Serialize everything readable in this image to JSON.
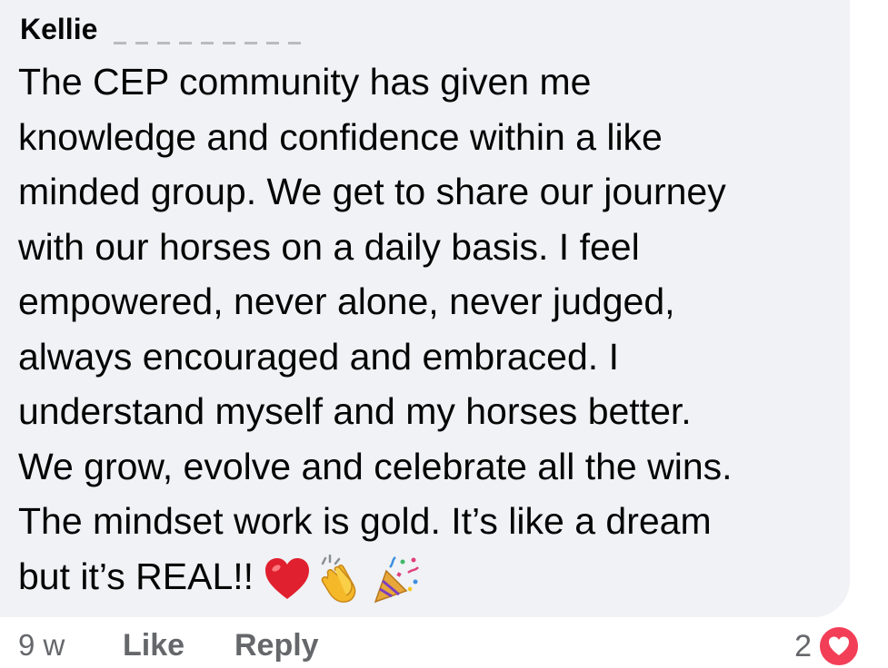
{
  "comment": {
    "author_name": "Kellie",
    "text_lines": [
      "The CEP community has given me",
      "knowledge and confidence within a like",
      "minded group. We get to share our journey",
      "with our horses on a daily basis. I feel",
      "empowered, never alone, never judged,",
      "always encouraged and embraced. I",
      "understand myself and my horses better.",
      "We grow, evolve and celebrate all the wins.",
      "The mindset work is gold. It’s like a dream",
      "but it’s REAL!!"
    ],
    "emojis": [
      "heart-icon",
      "clapping-hands-icon",
      "party-popper-icon"
    ]
  },
  "footer": {
    "time": "9 w",
    "like_label": "Like",
    "reply_label": "Reply",
    "reaction_count": "2",
    "reaction_icon": "love-reaction-icon"
  },
  "colors": {
    "bubble_bg": "#f0f2f5",
    "text": "#050505",
    "secondary_text": "#65676b",
    "love_reaction": "#f33e58",
    "heart_red": "#e0202e"
  }
}
